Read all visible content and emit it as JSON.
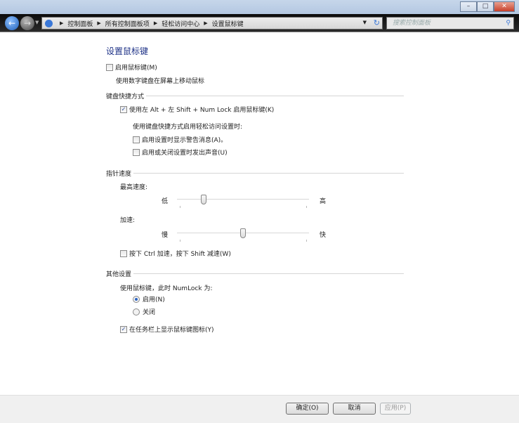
{
  "window": {
    "minimize": "–",
    "maximize": "□",
    "close": "✕"
  },
  "nav": {
    "breadcrumbs": [
      "控制面板",
      "所有控制面板项",
      "轻松访问中心",
      "设置鼠标键"
    ],
    "search_placeholder": "搜索控制面板"
  },
  "page": {
    "title": "设置鼠标键",
    "enable_mouse_keys": {
      "label": "启用鼠标键(M)",
      "checked": false
    },
    "enable_desc": "使用数字键盘在屏幕上移动鼠标",
    "keyboard_shortcut": {
      "heading": "键盘快捷方式",
      "shortcut": {
        "label": "使用左 Alt + 左 Shift + Num Lock 启用鼠标键(K)",
        "checked": true
      },
      "sub_desc": "使用键盘快捷方式启用轻松访问设置时:",
      "warning": {
        "label": "启用设置时显示警告消息(A)。",
        "checked": false
      },
      "sound": {
        "label": "启用或关闭设置时发出声音(U)",
        "checked": false
      }
    },
    "pointer_speed": {
      "heading": "指针速度",
      "top_speed": {
        "label": "最高速度:",
        "min_label": "低",
        "max_label": "高",
        "value": 0.19
      },
      "acceleration": {
        "label": "加速:",
        "min_label": "慢",
        "max_label": "快",
        "value": 0.5
      },
      "ctrl_shift": {
        "label": "按下 Ctrl 加速，按下 Shift 减速(W)",
        "checked": false
      }
    },
    "other": {
      "heading": "其他设置",
      "numlock_desc": "使用鼠标键，此时 NumLock 为:",
      "on": {
        "label": "启用(N)",
        "selected": true
      },
      "off": {
        "label": "关闭",
        "selected": false
      },
      "taskbar_icon": {
        "label": "在任务栏上显示鼠标键图标(Y)",
        "checked": true
      }
    }
  },
  "footer": {
    "ok": "确定(O)",
    "cancel": "取消",
    "apply": "应用(P)"
  }
}
